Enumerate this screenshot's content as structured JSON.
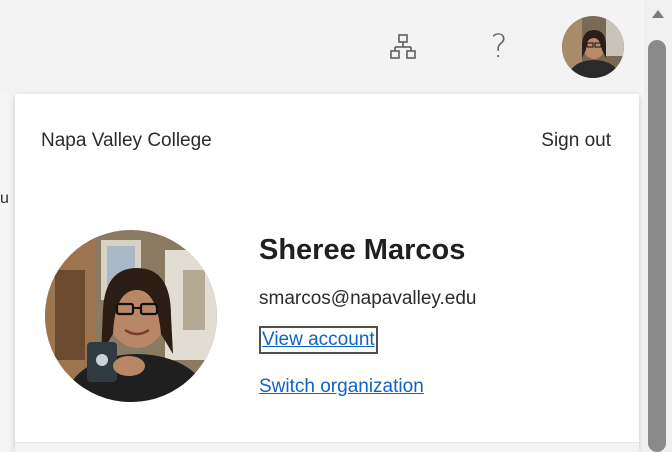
{
  "header": {
    "org_chart_icon": "hierarchy-icon",
    "help_label": "?",
    "profile_photo": "avatar"
  },
  "account_panel": {
    "organization": "Napa Valley College",
    "sign_out_label": "Sign out",
    "user_name": "Sheree Marcos",
    "user_email": "smarcos@napavalley.edu",
    "view_account_label": "View account",
    "switch_org_label": "Switch organization"
  },
  "background": {
    "left_edge_glyph": "u"
  },
  "colors": {
    "link": "#0f63c6",
    "panel_bg": "#ffffff",
    "topbar_bg": "#f3f3f3"
  }
}
